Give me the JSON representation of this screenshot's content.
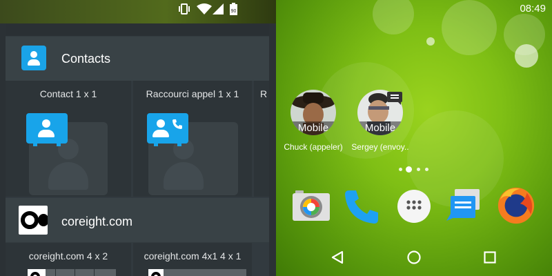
{
  "status_bar": {
    "time": "08:49",
    "icons": [
      "vibrate-icon",
      "wifi-icon",
      "signal-icon",
      "battery-icon"
    ],
    "battery_level": "90"
  },
  "widget_picker": {
    "sections": [
      {
        "app_name": "Contacts",
        "icon": "contacts-icon",
        "widgets": [
          {
            "label": "Contact  1 x 1"
          },
          {
            "label": "Raccourci appel  1 x 1"
          },
          {
            "label": "R"
          }
        ]
      },
      {
        "app_name": "coreight.com",
        "icon": "coreight-logo",
        "widgets": [
          {
            "label": "coreight.com  4 x 2"
          },
          {
            "label": "coreight.com 4x1  4 x 1"
          }
        ]
      }
    ]
  },
  "home_screen": {
    "shortcuts": [
      {
        "badge": "Mobile",
        "caption": "Chuck (appeler)"
      },
      {
        "badge": "Mobile",
        "caption": "Sergey (envoy.."
      }
    ],
    "page_indicator": {
      "pages": 4,
      "current": 2
    },
    "dock": [
      {
        "name": "camera-app-icon"
      },
      {
        "name": "phone-app-icon"
      },
      {
        "name": "app-drawer-icon"
      },
      {
        "name": "messenger-app-icon"
      },
      {
        "name": "firefox-app-icon"
      }
    ],
    "nav_bar": [
      "back-button",
      "home-button",
      "recents-button"
    ]
  },
  "colors": {
    "accent": "#1aa3e8",
    "scroll_thumb": "#4fb3c4",
    "panel": "#323a3f",
    "wallpaper": "#7fbf15"
  }
}
